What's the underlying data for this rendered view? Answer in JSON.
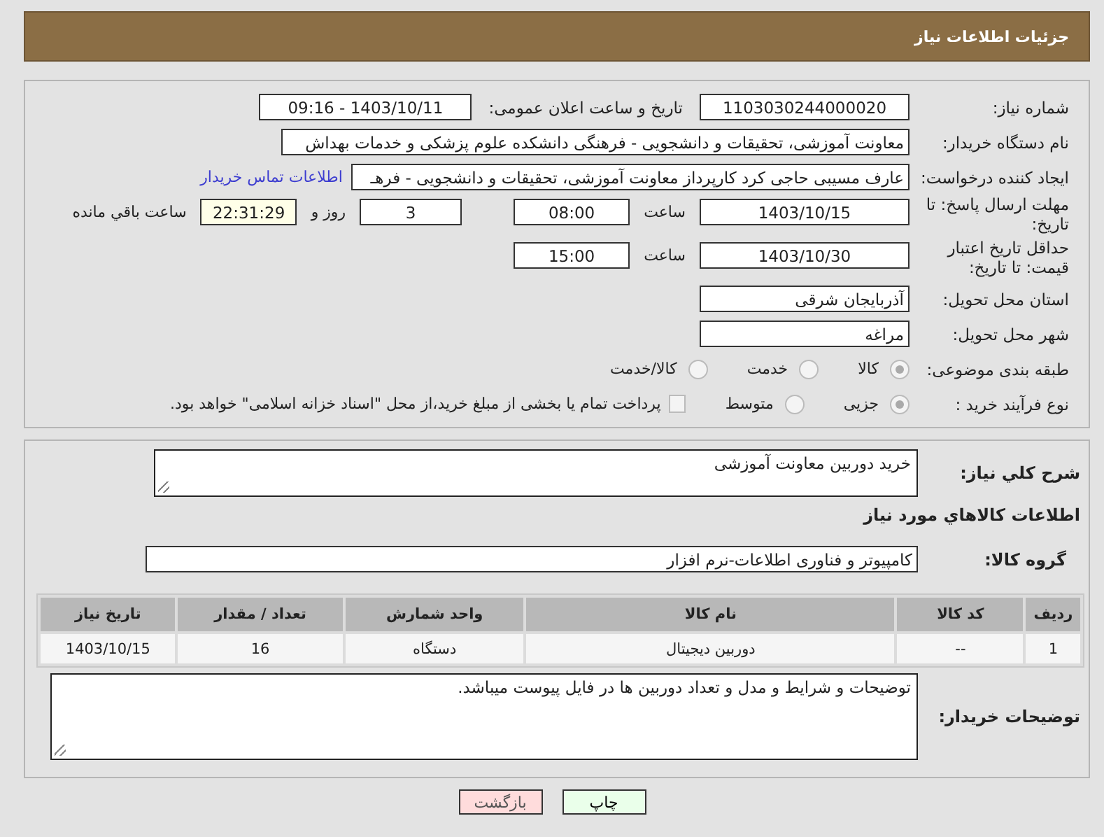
{
  "header": {
    "title": "جزئیات اطلاعات نیاز"
  },
  "need_number": {
    "label": "شماره نیاز:",
    "value": "1103030244000020"
  },
  "announce": {
    "label": "تاریخ و ساعت اعلان عمومی:",
    "value": "1403/10/11 - 09:16"
  },
  "buyer_org": {
    "label": "نام دستگاه خریدار:",
    "value": "معاونت آموزشی، تحقیقات و دانشجویی - فرهنگی دانشکده علوم پزشکی و خدمات بهداش"
  },
  "creator": {
    "label": "ایجاد کننده درخواست:",
    "value": "عارف مسیبی حاجی کرد کارپرداز معاونت آموزشی، تحقیقات و دانشجویی - فرهـ",
    "link": "اطلاعات تماس خریدار"
  },
  "deadline": {
    "label": "مهلت ارسال پاسخ: تا تاریخ:",
    "date": "1403/10/15",
    "time_label": "ساعت",
    "time": "08:00",
    "days": "3",
    "days_label": "روز و",
    "remaining": "22:31:29",
    "remaining_label": "ساعت باقي مانده"
  },
  "validity": {
    "label": "حداقل تاریخ اعتبار قیمت: تا تاریخ:",
    "date": "1403/10/30",
    "time_label": "ساعت",
    "time": "15:00"
  },
  "province": {
    "label": "استان محل تحویل:",
    "value": "آذربایجان شرقی"
  },
  "city": {
    "label": "شهر محل تحویل:",
    "value": "مراغه"
  },
  "category": {
    "label": "طبقه بندی موضوعی:",
    "options": [
      {
        "label": "كالا",
        "selected": true
      },
      {
        "label": "خدمت",
        "selected": false
      },
      {
        "label": "كالا/خدمت",
        "selected": false
      }
    ]
  },
  "purchase_type": {
    "label": "نوع فرآیند خرید :",
    "options": [
      {
        "label": "جزیی",
        "selected": true
      },
      {
        "label": "متوسط",
        "selected": false
      }
    ],
    "treasury": {
      "label": "پرداخت تمام یا بخشی از مبلغ خرید،از محل \"اسناد خزانه اسلامی\" خواهد بود.",
      "checked": false
    }
  },
  "summary": {
    "label": "شرح كلي نياز:",
    "value": "خرید دوربین معاونت آموزشی"
  },
  "goods_heading": "اطلاعات كالاهاي مورد نياز",
  "goods_group": {
    "label": "گروه كالا:",
    "value": "کامپیوتر و فناوری اطلاعات-نرم افزار"
  },
  "table": {
    "columns": [
      "رديف",
      "كد كالا",
      "نام كالا",
      "واحد شمارش",
      "تعداد / مقدار",
      "تاريخ نياز"
    ],
    "rows": [
      [
        "1",
        "--",
        "دوربین دیجیتال",
        "دستگاه",
        "16",
        "1403/10/15"
      ]
    ]
  },
  "buyer_notes": {
    "label": "توضیحات خریدار:",
    "value": "توضیحات و شرایط و مدل و تعداد دوربین ها در فایل پیوست میباشد."
  },
  "buttons": [
    {
      "label": "چاپ",
      "kind": "print"
    },
    {
      "label": "بازگشت",
      "kind": "back"
    }
  ]
}
